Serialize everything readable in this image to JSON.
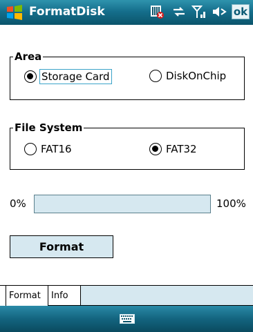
{
  "titlebar": {
    "title": "FormatDisk",
    "ok_label": "ok",
    "icons": [
      "windows-start-icon",
      "sim-card-missing-icon",
      "connectivity-icon",
      "signal-icon",
      "volume-icon"
    ]
  },
  "area": {
    "legend": "Area",
    "options": [
      {
        "label": "Storage Card",
        "selected": true
      },
      {
        "label": "DiskOnChip",
        "selected": false
      }
    ]
  },
  "file_system": {
    "legend": "File System",
    "options": [
      {
        "label": "FAT16",
        "selected": false
      },
      {
        "label": "FAT32",
        "selected": true
      }
    ]
  },
  "progress": {
    "min_label": "0%",
    "max_label": "100%",
    "value": 0
  },
  "actions": {
    "format_label": "Format"
  },
  "tabs": [
    {
      "label": "Format",
      "active": true
    },
    {
      "label": "Info",
      "active": false
    }
  ],
  "softbar": {
    "icon": "keyboard-icon"
  },
  "colors": {
    "accent": "#156f8c",
    "control_fill": "#d6e8f0"
  }
}
